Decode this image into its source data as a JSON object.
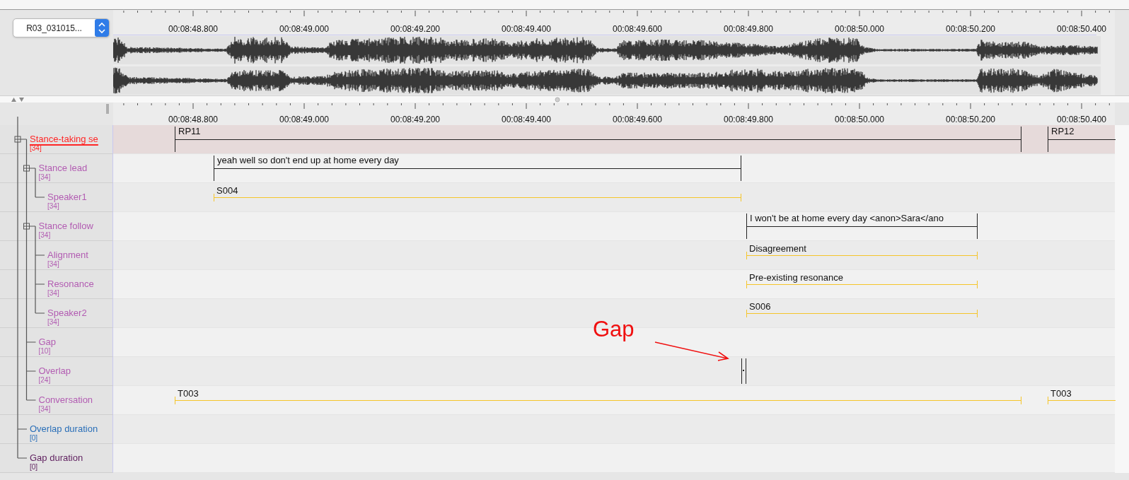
{
  "file_selector": {
    "value": "R03_031015..."
  },
  "ruler_top": {
    "labels": [
      "00:08:48.800",
      "00:08:49.000",
      "00:08:49.200",
      "00:08:49.400",
      "00:08:49.600",
      "00:08:49.800",
      "00:08:50.000",
      "00:08:50.200",
      "00:08:50.400"
    ]
  },
  "ruler_bottom": {
    "labels": [
      "00:08:48.800",
      "00:08:49.000",
      "00:08:49.200",
      "00:08:49.400",
      "00:08:49.600",
      "00:08:49.800",
      "00:08:50.000",
      "00:08:50.200",
      "00:08:50.400"
    ]
  },
  "tiers": [
    {
      "name": "Stance-taking se",
      "count": "[34]",
      "color": "#ff2626",
      "selected": true,
      "annotations": [
        {
          "kind": "parent",
          "value": "RP11"
        },
        {
          "kind": "parent",
          "value": "RP12"
        }
      ],
      "children": [
        {
          "name": "Stance lead",
          "count": "[34]",
          "color": "#b25cb2",
          "selected": false,
          "annotations": [
            {
              "kind": "parent",
              "value": "yeah well so don't end up at home every day"
            }
          ],
          "children": [
            {
              "name": "Speaker1",
              "count": "[34]",
              "color": "#b25cb2",
              "selected": false,
              "annotations": [
                {
                  "kind": "dependent",
                  "value": "S004"
                }
              ]
            }
          ]
        },
        {
          "name": "Stance follow",
          "count": "[34]",
          "color": "#b25cb2",
          "selected": false,
          "annotations": [
            {
              "kind": "parent",
              "value": "I won't be at home every day <anon>Sara</ano"
            }
          ],
          "children": [
            {
              "name": "Alignment",
              "count": "[34]",
              "color": "#b25cb2",
              "selected": false,
              "annotations": [
                {
                  "kind": "dependent",
                  "value": "Disagreement"
                }
              ]
            },
            {
              "name": "Resonance",
              "count": "[34]",
              "color": "#b25cb2",
              "selected": false,
              "annotations": [
                {
                  "kind": "dependent",
                  "value": "Pre-existing resonance"
                }
              ]
            },
            {
              "name": "Speaker2",
              "count": "[34]",
              "color": "#b25cb2",
              "selected": false,
              "annotations": [
                {
                  "kind": "dependent",
                  "value": "S006"
                }
              ]
            }
          ]
        },
        {
          "name": "Gap",
          "count": "[10]",
          "color": "#b25cb2",
          "selected": false
        },
        {
          "name": "Overlap",
          "count": "[24]",
          "color": "#b25cb2",
          "selected": false,
          "annotations": [
            {
              "kind": "marker"
            }
          ]
        },
        {
          "name": "Conversation",
          "count": "[34]",
          "color": "#b25cb2",
          "selected": false,
          "annotations": [
            {
              "kind": "dependent",
              "value": "T003"
            },
            {
              "kind": "dependent",
              "value": "T003"
            }
          ]
        }
      ]
    },
    {
      "name": "Overlap duration",
      "count": "[0]",
      "color": "#2a6fb8",
      "selected": false
    },
    {
      "name": "Gap duration",
      "count": "[0]",
      "color": "#5e1f5e",
      "selected": false
    }
  ],
  "callout": {
    "text": "Gap"
  }
}
